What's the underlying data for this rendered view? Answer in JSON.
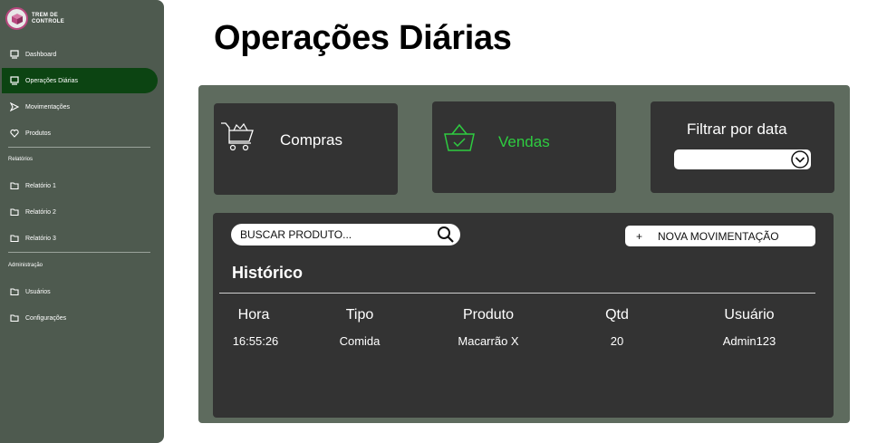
{
  "brand": {
    "line1": "TREM DE",
    "line2": "CONTROLE"
  },
  "sidebar": {
    "items": [
      {
        "label": "Dashboard"
      },
      {
        "label": "Operações Diárias"
      },
      {
        "label": "Movimentações"
      },
      {
        "label": "Produtos"
      }
    ],
    "reports_title": "Relatórios",
    "reports": [
      {
        "label": "Relatório 1"
      },
      {
        "label": "Relatório 2"
      },
      {
        "label": "Relatório 3"
      }
    ],
    "admin_title": "Administração",
    "admin": [
      {
        "label": "Usuários"
      },
      {
        "label": "Configurações"
      }
    ]
  },
  "page": {
    "title": "Operações Diárias"
  },
  "cards": {
    "compras": "Compras",
    "vendas": "Vendas",
    "filter_label": "Filtrar por data",
    "filter_value": ""
  },
  "history": {
    "search_placeholder": "BUSCAR PRODUTO...",
    "new_button_plus": "+",
    "new_button_label": "NOVA MOVIMENTAÇÃO",
    "title": "Histórico",
    "columns": [
      "Hora",
      "Tipo",
      "Produto",
      "Qtd",
      "Usuário"
    ],
    "rows": [
      [
        "16:55:26",
        "Comida",
        "Macarrão X",
        "20",
        "Admin123"
      ]
    ]
  },
  "colors": {
    "sidebar_bg": "#4e5a4f",
    "sidebar_active": "#0c4412",
    "panel_bg": "#5e6b5e",
    "card_bg": "#333333",
    "accent_green": "#2ecc40"
  },
  "icons": [
    "cube-logo-icon",
    "monitor-icon",
    "send-icon",
    "heart-icon",
    "folder-icon",
    "cart-icon",
    "basket-check-icon",
    "chevron-down-circle-icon",
    "search-icon"
  ]
}
